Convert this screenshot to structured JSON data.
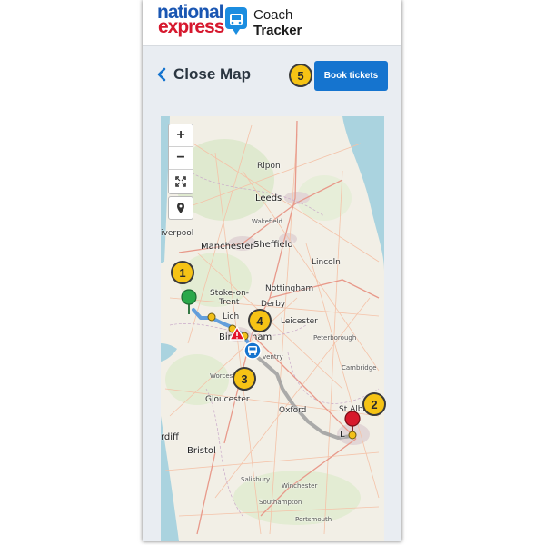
{
  "header": {
    "brand_line1": "national",
    "brand_line2": "express",
    "product_line1": "Coach",
    "product_line2": "Tracker"
  },
  "toolbar": {
    "close_label": "Close Map",
    "book_label": "Book tickets"
  },
  "map": {
    "zoom_in": "+",
    "zoom_out": "−",
    "cities": {
      "ripon": "Ripon",
      "leeds": "Leeds",
      "wakefield": "Wakefield",
      "liverpool": "iverpool",
      "manchester": "Manchester",
      "sheffield": "Sheffield",
      "lincoln": "Lincoln",
      "stoke1": "Stoke-on-",
      "stoke2": "Trent",
      "nottingham": "Nottingham",
      "derby": "Derby",
      "lich": "Lich",
      "birmingham1": "Bir",
      "birmingham2": "ham",
      "leicester": "Leicester",
      "peterborough": "Peterborough",
      "coventry": "ventry",
      "worcester": "Worces",
      "cambridge": "Cambridge",
      "gloucester": "Gloucester",
      "oxford": "Oxford",
      "stalbans": "St Alban",
      "london": "L",
      "cardiff": "rdiff",
      "bristol": "Bristol",
      "salisbury": "Salisbury",
      "winchester": "Winchester",
      "southampton": "Southampton",
      "portsmouth": "Portsmouth"
    }
  },
  "callouts": [
    "1",
    "2",
    "3",
    "4",
    "5"
  ],
  "colors": {
    "brand_blue": "#1a56b2",
    "brand_red": "#d6182e",
    "button_blue": "#1574cf",
    "route_done": "#4a90d9",
    "route_remaining": "#9e9e9e",
    "origin_pin": "#2aa84a",
    "destination_pin": "#d7192c",
    "callout_fill": "#f6c315"
  }
}
